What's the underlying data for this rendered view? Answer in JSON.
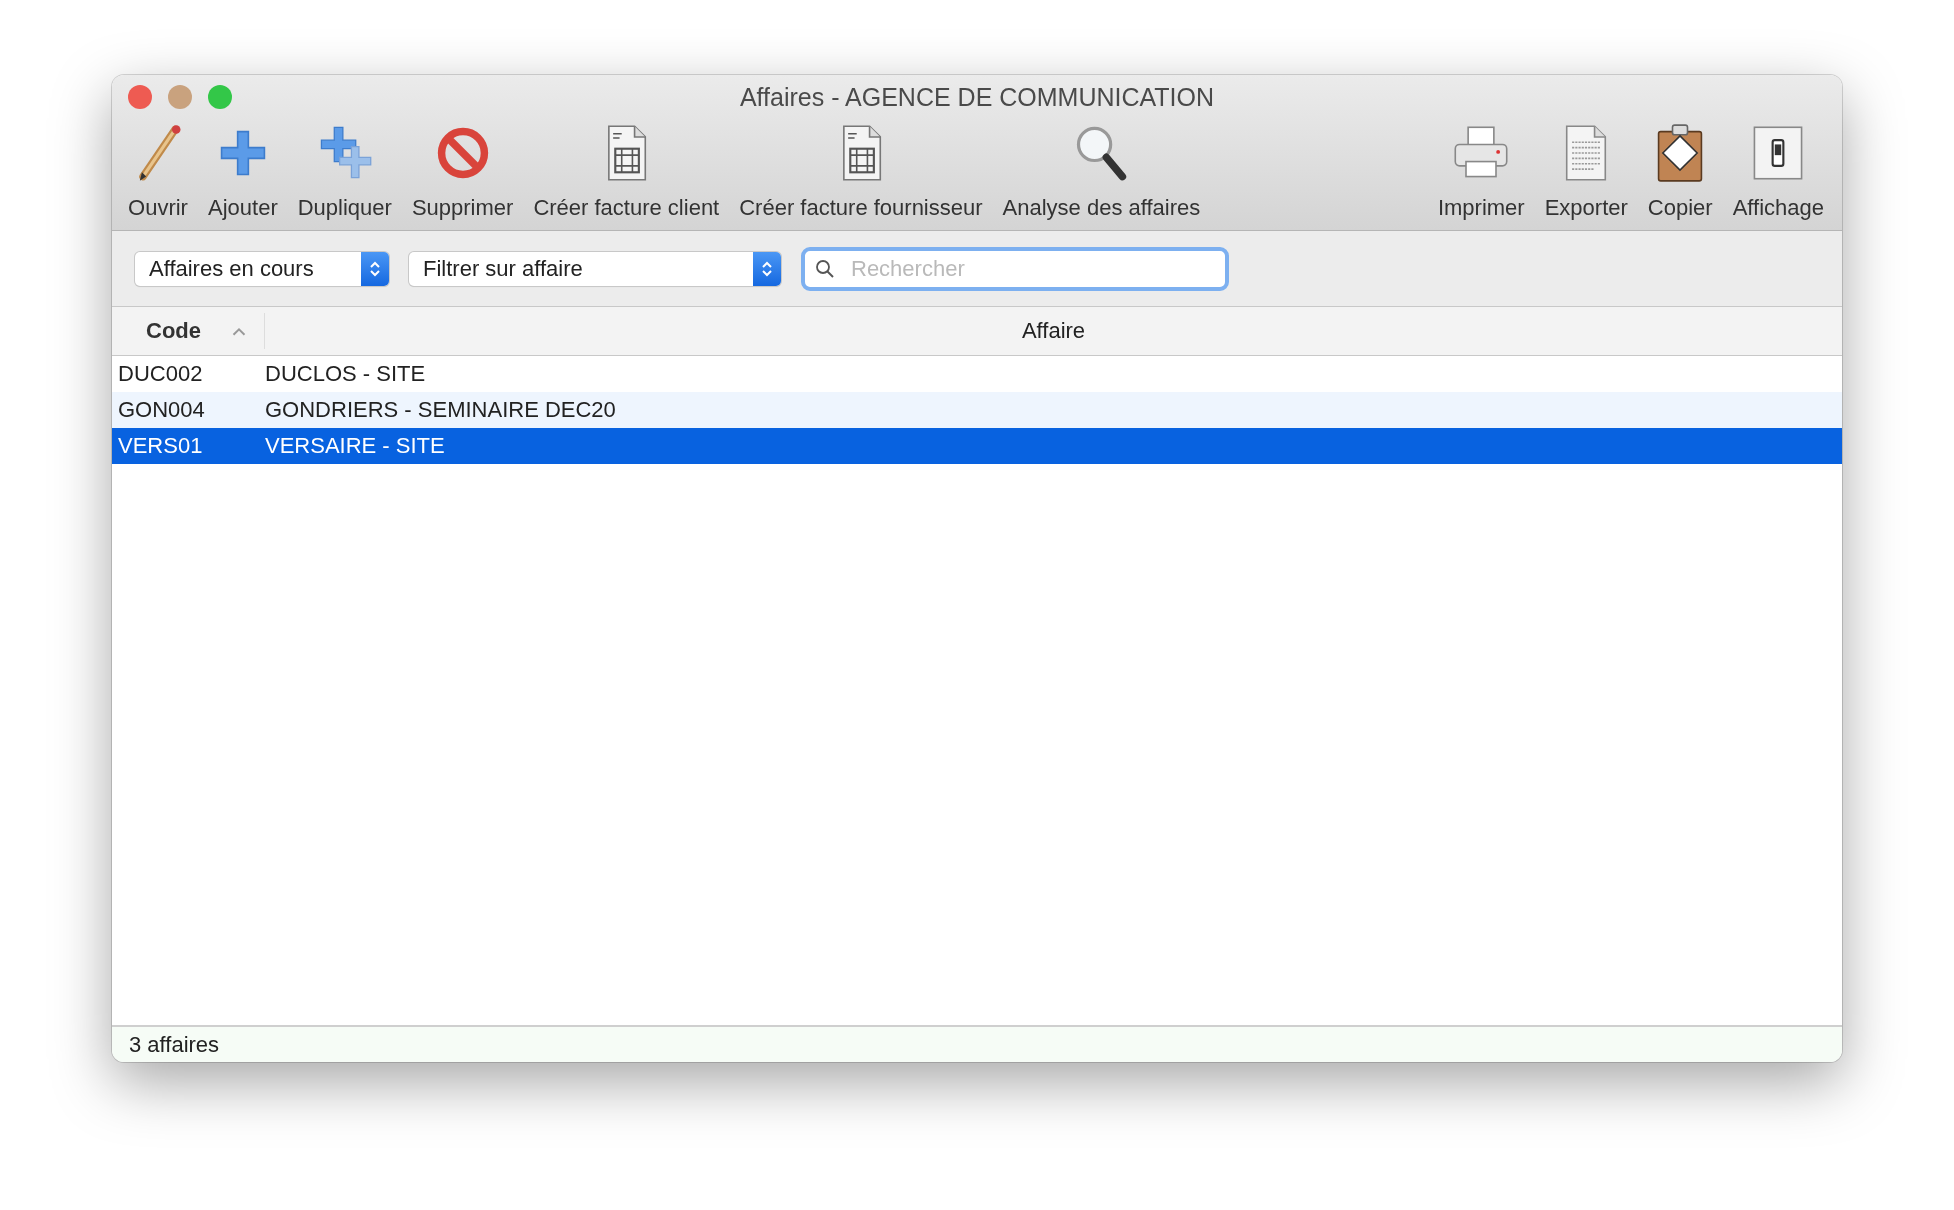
{
  "window": {
    "title": "Affaires - AGENCE DE COMMUNICATION"
  },
  "toolbar": {
    "left": [
      {
        "label": "Ouvrir",
        "kind": "pencil"
      },
      {
        "label": "Ajouter",
        "kind": "plus"
      },
      {
        "label": "Dupliquer",
        "kind": "duplicate"
      },
      {
        "label": "Supprimer",
        "kind": "forbidden"
      },
      {
        "label": "Créer facture client",
        "kind": "invoice"
      },
      {
        "label": "Créer facture fournisseur",
        "kind": "invoice"
      },
      {
        "label": "Analyse des affaires",
        "kind": "magnifier"
      }
    ],
    "right": [
      {
        "label": "Imprimer",
        "kind": "printer"
      },
      {
        "label": "Exporter",
        "kind": "document"
      },
      {
        "label": "Copier",
        "kind": "clipboard"
      },
      {
        "label": "Affichage",
        "kind": "switch"
      }
    ]
  },
  "filters": {
    "status_select": "Affaires en cours",
    "affaire_select": "Filtrer sur affaire",
    "search": {
      "placeholder": "Rechercher"
    }
  },
  "table": {
    "columns": [
      {
        "label": "Code",
        "sorted": true
      },
      {
        "label": "Affaire",
        "sorted": false
      }
    ],
    "rows": [
      {
        "code": "DUC002",
        "affaire": "DUCLOS - SITE",
        "selected": false
      },
      {
        "code": "GON004",
        "affaire": "GONDRIERS - SEMINAIRE DEC20",
        "selected": false
      },
      {
        "code": "VERS01",
        "affaire": "VERSAIRE - SITE",
        "selected": true
      }
    ]
  },
  "status_bar": "3 affaires"
}
